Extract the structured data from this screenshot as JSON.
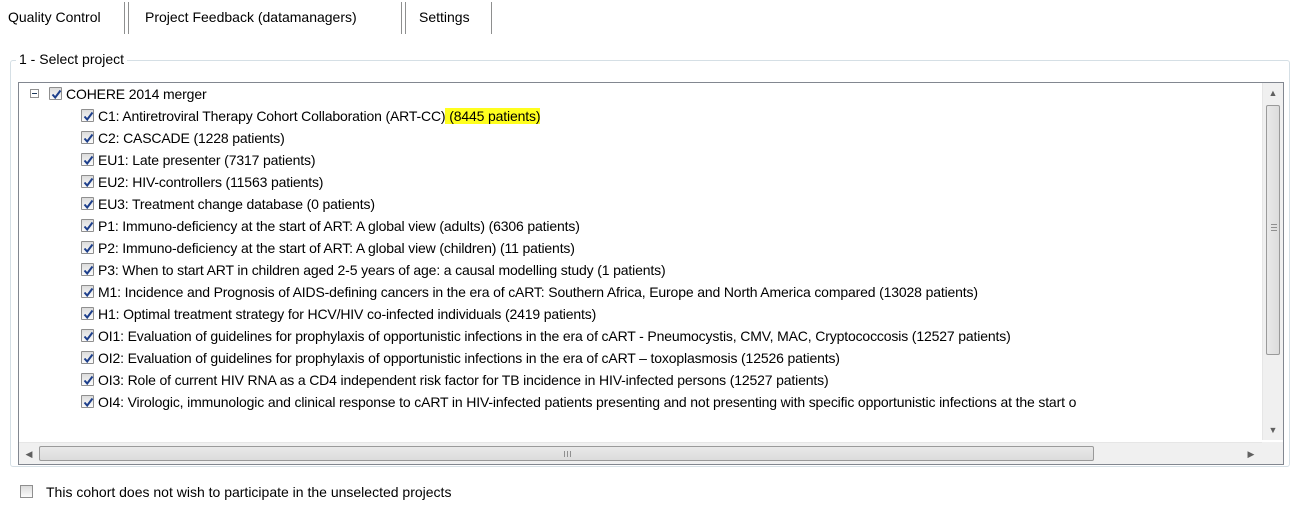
{
  "tabs": [
    {
      "label": "Quality Control",
      "active": true
    },
    {
      "label": "Project Feedback (datamanagers)",
      "active": false
    },
    {
      "label": "Settings",
      "active": false
    }
  ],
  "group_title": "1 - Select project",
  "tree": {
    "root": {
      "label": "COHERE 2014 merger",
      "checked": true,
      "expanded": true
    },
    "items": [
      {
        "label": "C1: Antiretroviral Therapy Cohort Collaboration (ART-CC)",
        "highlight": " (8445 patients)",
        "checked": true
      },
      {
        "label": "C2: CASCADE (1228 patients)",
        "checked": true
      },
      {
        "label": "EU1: Late presenter (7317 patients)",
        "checked": true
      },
      {
        "label": "EU2: HIV-controllers (11563 patients)",
        "checked": true
      },
      {
        "label": "EU3: Treatment change database (0 patients)",
        "checked": true
      },
      {
        "label": "P1: Immuno-deficiency at the start of ART: A global view (adults) (6306 patients)",
        "checked": true
      },
      {
        "label": "P2: Immuno-deficiency at the start of ART: A global view (children) (11 patients)",
        "checked": true
      },
      {
        "label": "P3: When to start ART in children aged 2-5 years of age: a causal modelling study (1 patients)",
        "checked": true
      },
      {
        "label": "M1: Incidence and Prognosis of AIDS-defining cancers in the era of cART: Southern Africa, Europe and North America compared (13028 patients)",
        "checked": true
      },
      {
        "label": "H1: Optimal treatment strategy for HCV/HIV co-infected individuals (2419 patients)",
        "checked": true
      },
      {
        "label": "OI1: Evaluation of guidelines for prophylaxis of opportunistic infections in the era of cART - Pneumocystis, CMV, MAC, Cryptococcosis (12527 patients)",
        "checked": true
      },
      {
        "label": "OI2: Evaluation of guidelines for prophylaxis of opportunistic infections in the era of cART – toxoplasmosis (12526 patients)",
        "checked": true
      },
      {
        "label": "OI3: Role of current HIV RNA as a CD4 independent risk factor for TB incidence in HIV-infected persons (12527 patients)",
        "checked": true
      },
      {
        "label": "OI4: Virologic, immunologic and clinical response to cART in HIV-infected patients presenting and not presenting with specific opportunistic infections at the start o",
        "checked": true
      }
    ]
  },
  "scrollbar": {
    "h_grip": "III",
    "v_grip": "≡"
  },
  "bottom_option": {
    "label": "This cohort does not wish to participate in the unselected projects",
    "checked": false
  },
  "colors": {
    "highlight": "#ffff1e",
    "check": "#1d3f8b"
  }
}
